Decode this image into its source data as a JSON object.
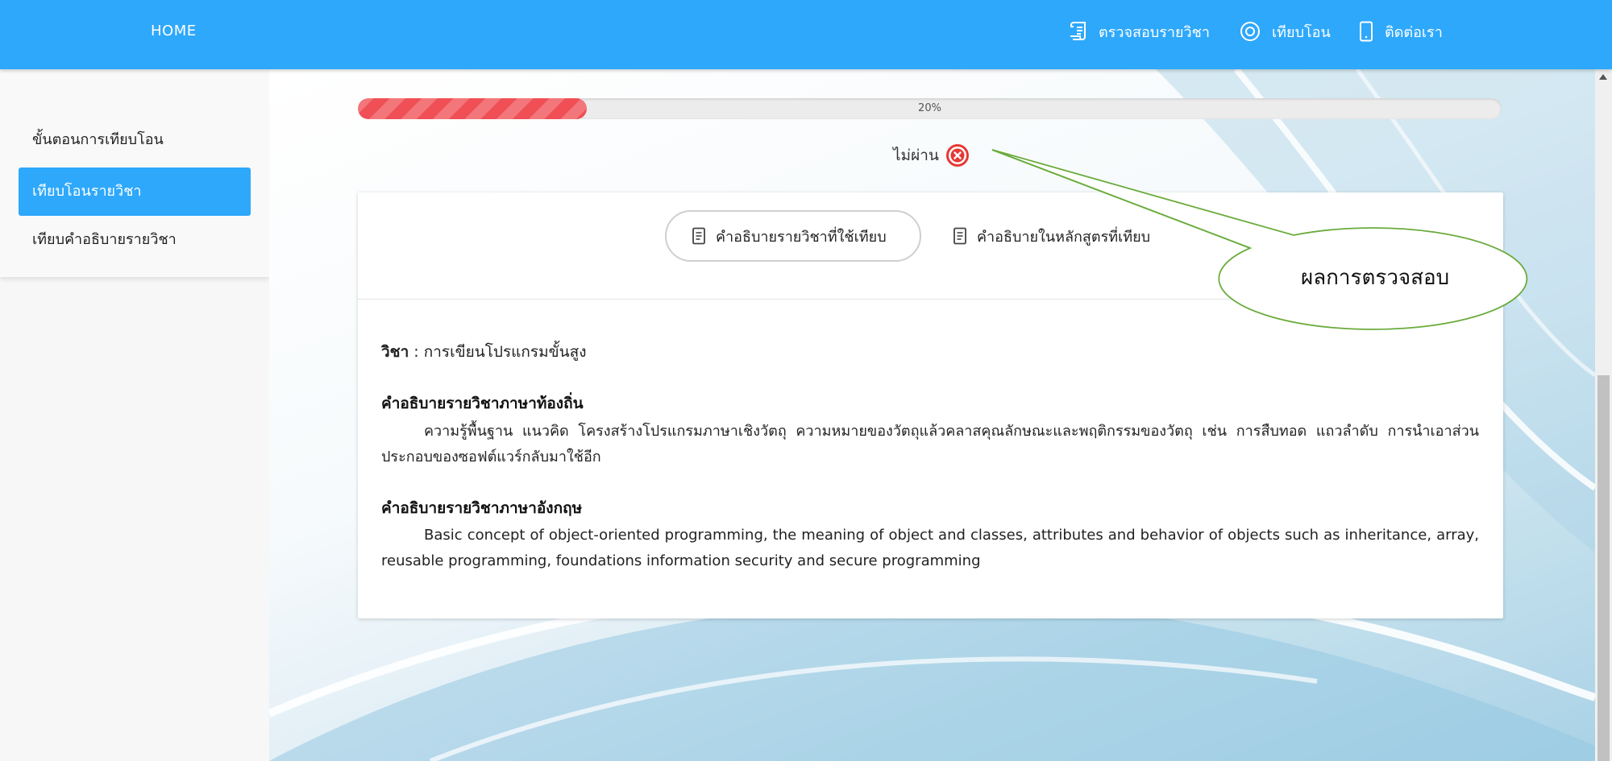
{
  "nav": {
    "home": "HOME",
    "check_course": "ตรวจสอบรายวิชา",
    "compare": "เทียบโอน",
    "contact": "ติดต่อเรา"
  },
  "sidebar": {
    "items": [
      {
        "label": "ขั้นตอนการเทียบโอน",
        "active": false
      },
      {
        "label": "เทียบโอนรายวิชา",
        "active": true
      },
      {
        "label": "เทียบคำอธิบายรายวิชา",
        "active": false
      }
    ]
  },
  "progress": {
    "label": "20%",
    "value": 0.2
  },
  "result": {
    "label": "ไม่ผ่าน",
    "status_color": "#e53935"
  },
  "tabs": {
    "used": "คำอธิบายรายวิชาที่ใช้เทียบ",
    "compared": "คำอธิบายในหลักสูตรที่เทียบ"
  },
  "course": {
    "subject_label": "วิชา",
    "separator": ":",
    "subject_name": "การเขียนโปรแกรมขั้นสูง",
    "local_heading": "คำอธิบายรายวิชาภาษาท้องถิ่น",
    "local_desc": "ความรู้พื้นฐาน แนวคิด โครงสร้างโปรแกรมภาษาเชิงวัตถุ ความหมายของวัตถุแล้วคลาสคุณลักษณะและพฤติกรรมของวัตถุ เช่น การสืบทอด แถวลำดับ การนำเอาส่วนประกอบของซอฟต์แวร์กลับมาใช้อีก",
    "en_heading": "คำอธิบายรายวิชาภาษาอังกฤษ",
    "en_desc": "Basic concept of object-oriented programming, the meaning of object and classes, attributes and behavior of objects such as inheritance, array, reusable programming, foundations information security and secure programming"
  },
  "callout": {
    "label": "ผลการตรวจสอบ"
  },
  "colors": {
    "accent": "#2ea8fb",
    "progress_fill": "#ef4f55",
    "callout_stroke": "#6aab3c"
  }
}
